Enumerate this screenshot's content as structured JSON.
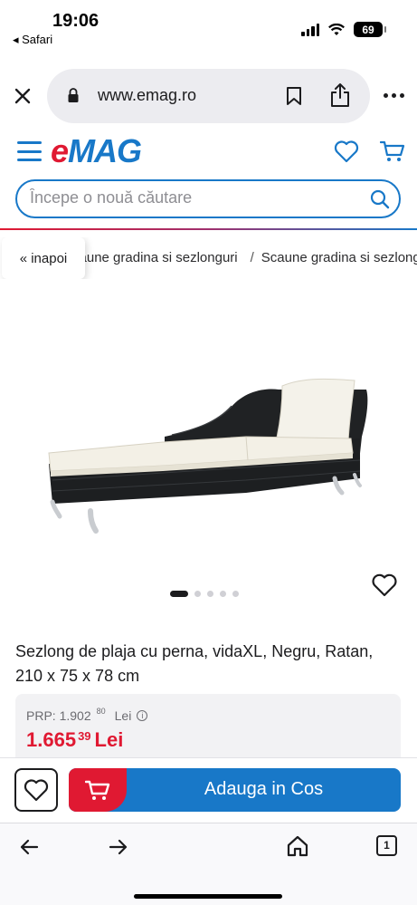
{
  "status_bar": {
    "time": "19:06",
    "back_app": "◂ Safari",
    "battery": "69"
  },
  "browser": {
    "url": "www.emag.ro",
    "open_tabs": "1"
  },
  "site": {
    "logo_e": "e",
    "logo_mag": "MAG",
    "search_placeholder": "Începe o nouă căutare"
  },
  "breadcrumb": {
    "back_label": "« inapoi",
    "items": [
      "Scaune gradina si sezlonguri",
      "Scaune gradina si sezlonguri vidaXL"
    ],
    "separator": "/"
  },
  "gallery": {
    "slide_count": 5,
    "active_index": 0
  },
  "product": {
    "title": "Sezlong de plaja cu perna, vidaXL, Negru, Ratan, 210 x 75 x 78 cm"
  },
  "pricing": {
    "prp_label": "PRP: 1.902",
    "prp_cents": "80",
    "prp_currency": "Lei",
    "price_int": "1.665",
    "price_cents": "39",
    "price_currency": "Lei"
  },
  "actions": {
    "add_to_cart": "Adauga in Cos"
  },
  "colors": {
    "brand_red": "#e01932",
    "brand_blue": "#1878c8"
  },
  "icons": [
    "close-icon",
    "lock-icon",
    "bookmark-icon",
    "share-icon",
    "more-icon",
    "menu-icon",
    "heart-icon",
    "cart-icon",
    "search-icon",
    "info-icon",
    "back-arrow-icon",
    "forward-arrow-icon",
    "home-icon",
    "tabs-icon"
  ]
}
